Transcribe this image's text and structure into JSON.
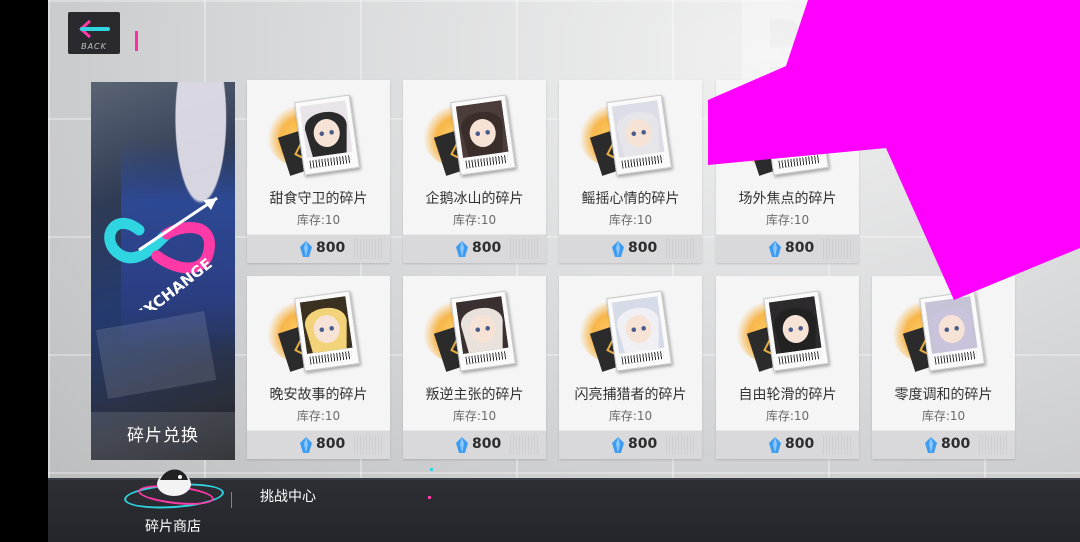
{
  "header": {
    "back_label": "BACK"
  },
  "banner": {
    "logo_text": "EXCHANGE",
    "label": "碎片兑换"
  },
  "currency_icon": "crystal-gem-icon",
  "colors": {
    "accent_pink": "#ff2fa3",
    "accent_cyan": "#2fd5e0",
    "overlay_magenta": "#ff00ff",
    "gem_blue": "#3d9bf0"
  },
  "shop_items": [
    {
      "name": "甜食守卫的碎片",
      "stock": "库存:10",
      "price": "800"
    },
    {
      "name": "企鹅冰山的碎片",
      "stock": "库存:10",
      "price": "800"
    },
    {
      "name": "鳐摇心情的碎片",
      "stock": "库存:10",
      "price": "800"
    },
    {
      "name": "场外焦点的碎片",
      "stock": "库存:10",
      "price": "800"
    },
    {
      "name": "晚安故事的碎片",
      "stock": "库存:10",
      "price": "800"
    },
    {
      "name": "叛逆主张的碎片",
      "stock": "库存:10",
      "price": "800"
    },
    {
      "name": "闪亮捕猎者的碎片",
      "stock": "库存:10",
      "price": "800"
    },
    {
      "name": "自由轮滑的碎片",
      "stock": "库存:10",
      "price": "800"
    },
    {
      "name": "零度调和的碎片",
      "stock": "库存:10",
      "price": "800"
    }
  ],
  "bottom_nav": {
    "active_tab": "碎片商店",
    "tab_challenge": "挑战中心"
  }
}
